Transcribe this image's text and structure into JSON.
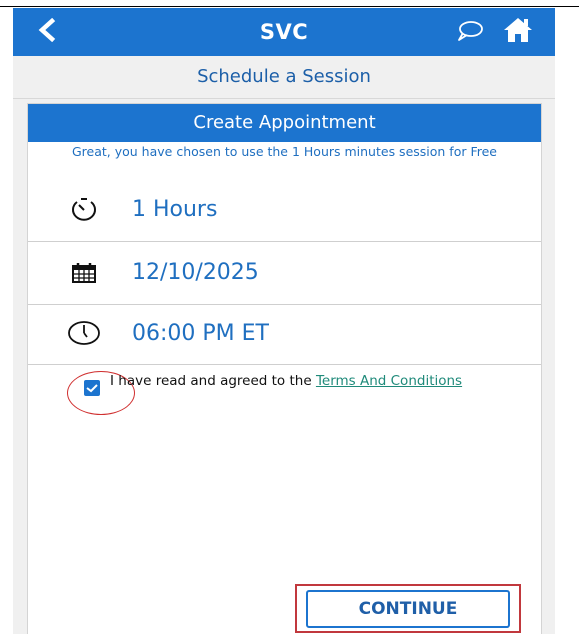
{
  "app_bar": {
    "title": "SVC",
    "icons": {
      "back": "chevron-left-icon",
      "chat": "chat-bubble-icon",
      "home": "home-icon"
    }
  },
  "subheader": {
    "title": "Schedule a Session"
  },
  "card": {
    "header": "Create Appointment",
    "note": "Great, you have chosen to use the 1 Hours minutes session for Free",
    "rows": [
      {
        "icon": "stopwatch-icon",
        "value": "1 Hours"
      },
      {
        "icon": "calendar-icon",
        "value": "12/10/2025"
      },
      {
        "icon": "clock-icon",
        "value": "06:00 PM ET"
      }
    ],
    "agreement": {
      "checked": true,
      "text": "I have read and agreed to the ",
      "link": "Terms And Conditions"
    },
    "continue_label": "CONTINUE"
  },
  "colors": {
    "brand": "#1c74cf",
    "text_blue": "#1f6fc0",
    "highlight_red": "#c1383d",
    "link": "#1f8a7a"
  }
}
